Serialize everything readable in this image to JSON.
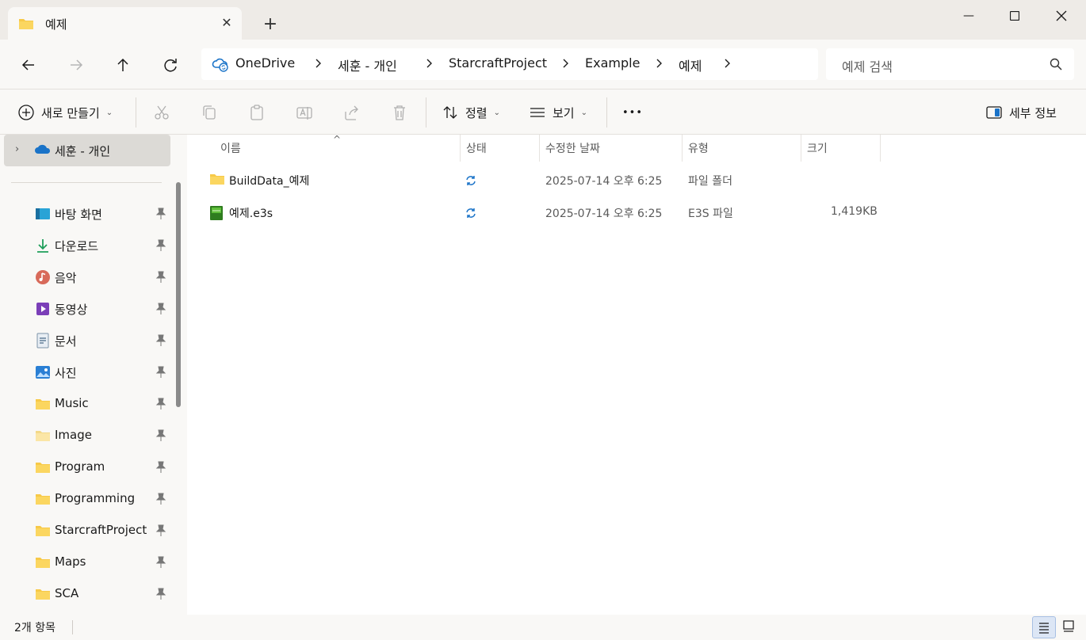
{
  "window": {
    "tab_title": "예제",
    "tab_close": "✕",
    "new_tab": "+",
    "minimize": "—",
    "maximize": "☐",
    "close": "✕"
  },
  "address": {
    "crumbs": [
      "OneDrive",
      "세훈 - 개인",
      "StarcraftProject",
      "Example",
      "예제"
    ],
    "search_placeholder": "예제 검색"
  },
  "commands": {
    "new": "새로 만들기",
    "sort": "정렬",
    "view": "보기",
    "more": "•••",
    "details": "세부 정보"
  },
  "sidebar": {
    "root": "세훈 - 개인",
    "items": [
      {
        "label": "바탕 화면",
        "icon": "desktop-icon"
      },
      {
        "label": "다운로드",
        "icon": "download-icon"
      },
      {
        "label": "음악",
        "icon": "music-icon"
      },
      {
        "label": "동영상",
        "icon": "video-icon"
      },
      {
        "label": "문서",
        "icon": "document-icon"
      },
      {
        "label": "사진",
        "icon": "picture-icon"
      },
      {
        "label": "Music",
        "icon": "folder-icon"
      },
      {
        "label": "Image",
        "icon": "folder-icon"
      },
      {
        "label": "Program",
        "icon": "folder-icon"
      },
      {
        "label": "Programming",
        "icon": "folder-icon"
      },
      {
        "label": "StarcraftProject",
        "icon": "folder-icon"
      },
      {
        "label": "Maps",
        "icon": "folder-icon"
      },
      {
        "label": "SCA",
        "icon": "folder-icon"
      }
    ]
  },
  "table": {
    "headers": {
      "name": "이름",
      "status": "상태",
      "modified": "수정한 날짜",
      "type": "유형",
      "size": "크기"
    },
    "rows": [
      {
        "name": "BuildData_예제",
        "modified": "2025-07-14 오후 6:25",
        "type": "파일 폴더",
        "size": "",
        "icon": "folder-icon"
      },
      {
        "name": "예제.e3s",
        "modified": "2025-07-14 오후 6:25",
        "type": "E3S 파일",
        "size": "1,419KB",
        "icon": "e3s-file-icon"
      }
    ]
  },
  "status": {
    "item_count": "2개 항목"
  },
  "colors": {
    "chrome": "#f9f8f6",
    "titlebar": "#eeebe7",
    "folder": "#f7c948",
    "sync_blue": "#1a73c8",
    "selection": "#dcdad6"
  }
}
